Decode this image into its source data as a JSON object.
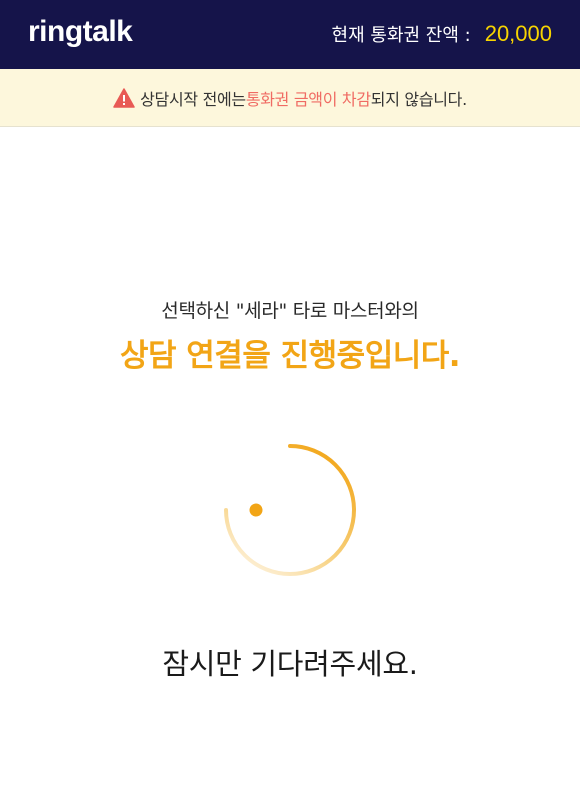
{
  "header": {
    "logo": "ringtalk",
    "balance_label": "현재 통화권 잔액 :",
    "balance_value": "20,000"
  },
  "notice": {
    "icon": "warning-triangle-icon",
    "text_before": "상담시작 전에는 ",
    "text_highlight": "통화권 금액이 차감",
    "text_after": "되지 않습니다.",
    "highlight_color": "#f06b63"
  },
  "main": {
    "intro": "선택하신 \"세라\" 타로 마스터와의",
    "headline": "상담 연결을 진행중입니다.",
    "spinner_icon": "loading-spinner-icon",
    "wait_text": "잠시만 기다려주세요."
  },
  "colors": {
    "header_bg": "#15144a",
    "accent": "#f2a516",
    "balance": "#f7d400",
    "notice_bg": "#fdf7dc"
  }
}
